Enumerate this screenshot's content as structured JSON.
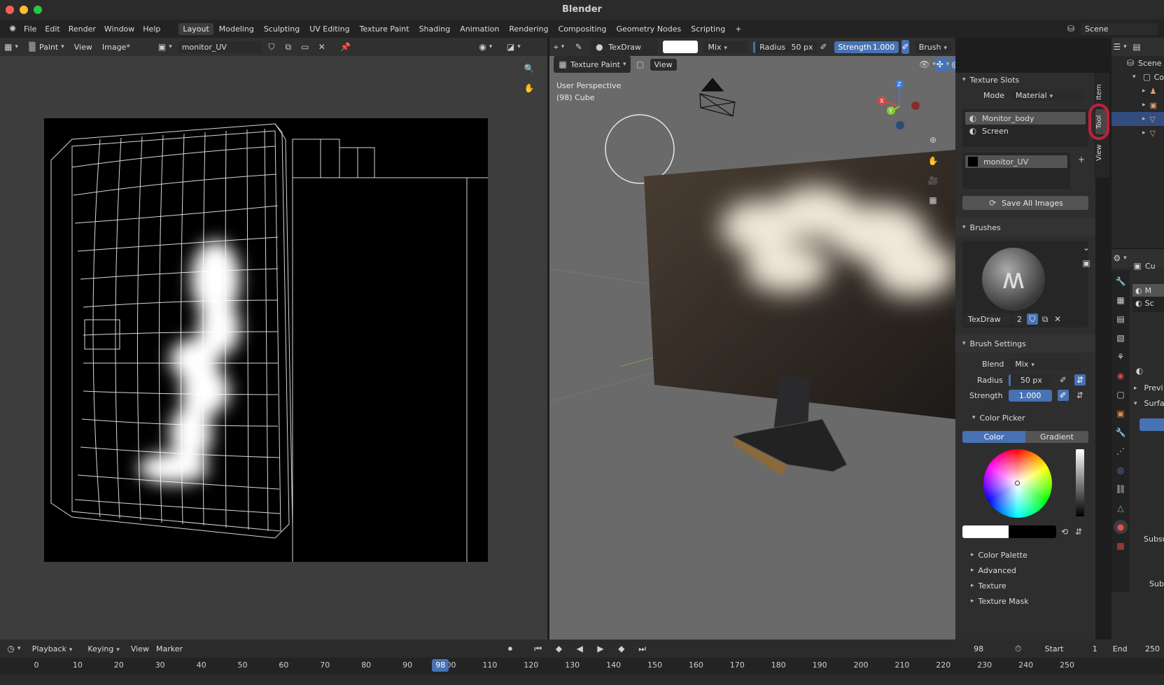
{
  "window": {
    "title": "Blender"
  },
  "menubar": {
    "items": [
      "File",
      "Edit",
      "Render",
      "Window",
      "Help"
    ]
  },
  "workspaces": {
    "tabs": [
      "Layout",
      "Modeling",
      "Sculpting",
      "UV Editing",
      "Texture Paint",
      "Shading",
      "Animation",
      "Rendering",
      "Compositing",
      "Geometry Nodes",
      "Scripting"
    ],
    "active": "Layout",
    "add": "+"
  },
  "scene": {
    "name": "Scene"
  },
  "image_editor": {
    "mode": "Paint",
    "view": "View",
    "image_menu": "Image*",
    "image_name": "monitor_UV"
  },
  "tool_header": {
    "brush_name": "TexDraw",
    "blend": "Mix",
    "radius_label": "Radius",
    "radius_value": "50 px",
    "strength_label": "Strength",
    "strength_value": "1.000",
    "brush_menu": "Brush"
  },
  "viewport": {
    "mode": "Texture Paint",
    "view": "View",
    "perspective": "User Perspective",
    "object": "(98) Cube",
    "gizmo": {
      "x": "X",
      "y": "Y",
      "z": "Z"
    }
  },
  "sidebar": {
    "tabs": [
      "Item",
      "Tool",
      "View"
    ],
    "texture_slots": {
      "title": "Texture Slots",
      "mode_label": "Mode",
      "mode_value": "Material",
      "materials": [
        "Monitor_body",
        "Screen"
      ],
      "image": "monitor_UV",
      "save_all": "Save All Images"
    },
    "brushes": {
      "title": "Brushes",
      "name": "TexDraw",
      "users": "2"
    },
    "brush_settings": {
      "title": "Brush Settings",
      "blend_label": "Blend",
      "blend_value": "Mix",
      "radius_label": "Radius",
      "radius_value": "50 px",
      "strength_label": "Strength",
      "strength_value": "1.000"
    },
    "color_picker": {
      "title": "Color Picker",
      "tab_color": "Color",
      "tab_gradient": "Gradient"
    },
    "collapsed": [
      "Color Palette",
      "Advanced",
      "Texture",
      "Texture Mask"
    ]
  },
  "outliner": {
    "title": "Scene",
    "row": "Co"
  },
  "properties": {
    "object": "Cu",
    "mat1": "M",
    "mat2": "Sc",
    "preview": "Previ",
    "surface": "Surfa",
    "sub1": "Subsu",
    "sub2": "Subs"
  },
  "timeline": {
    "playback": "Playback",
    "keying": "Keying",
    "view": "View",
    "marker": "Marker",
    "current_frame": "98",
    "start_label": "Start",
    "start_value": "1",
    "end_label": "End",
    "end_value": "250",
    "ticks": [
      "0",
      "10",
      "20",
      "30",
      "40",
      "50",
      "60",
      "70",
      "80",
      "90",
      "100",
      "110",
      "120",
      "130",
      "140",
      "150",
      "160",
      "170",
      "180",
      "190",
      "200",
      "210",
      "220",
      "230",
      "240",
      "250"
    ]
  },
  "colors": {
    "accent": "#4772b3",
    "bg": "#1d1d1d",
    "panel": "#303030",
    "highlight": "#c0203a"
  }
}
